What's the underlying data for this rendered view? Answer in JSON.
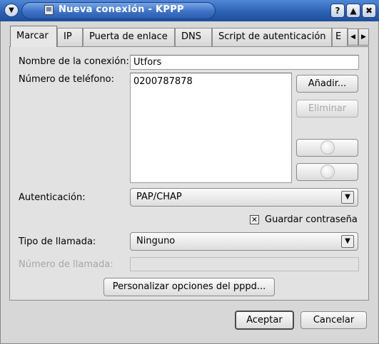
{
  "window": {
    "title": "Nueva conexión - KPPP",
    "menu_glyph": "▼",
    "help_glyph": "?",
    "maximize_glyph": "▲",
    "close_glyph": "✖"
  },
  "tabs": [
    {
      "label": "Marcar",
      "active": true
    },
    {
      "label": "IP"
    },
    {
      "label": "Puerta de enlace"
    },
    {
      "label": "DNS"
    },
    {
      "label": "Script de autenticación"
    },
    {
      "label": "E"
    }
  ],
  "tab_scroll": {
    "left": "◀",
    "right": "▶"
  },
  "form": {
    "connection_name_label": "Nombre de la conexión:",
    "connection_name_value": "Utfors",
    "phone_label": "Número de teléfono:",
    "phone_numbers": [
      "0200787878"
    ],
    "add_button": "Añadir...",
    "remove_button": "Eliminar",
    "auth_label": "Autenticación:",
    "auth_value": "PAP/CHAP",
    "save_password_label": "Guardar contraseña",
    "save_password_checked": true,
    "call_type_label": "Tipo de llamada:",
    "call_type_value": "Ninguno",
    "call_number_label": "Número de llamada:",
    "call_number_value": "",
    "pppd_button": "Personalizar opciones del pppd...",
    "combo_arrow_glyph": "▼",
    "check_glyph": "✕"
  },
  "footer": {
    "ok_button": "Aceptar",
    "cancel_button": "Cancelar"
  }
}
